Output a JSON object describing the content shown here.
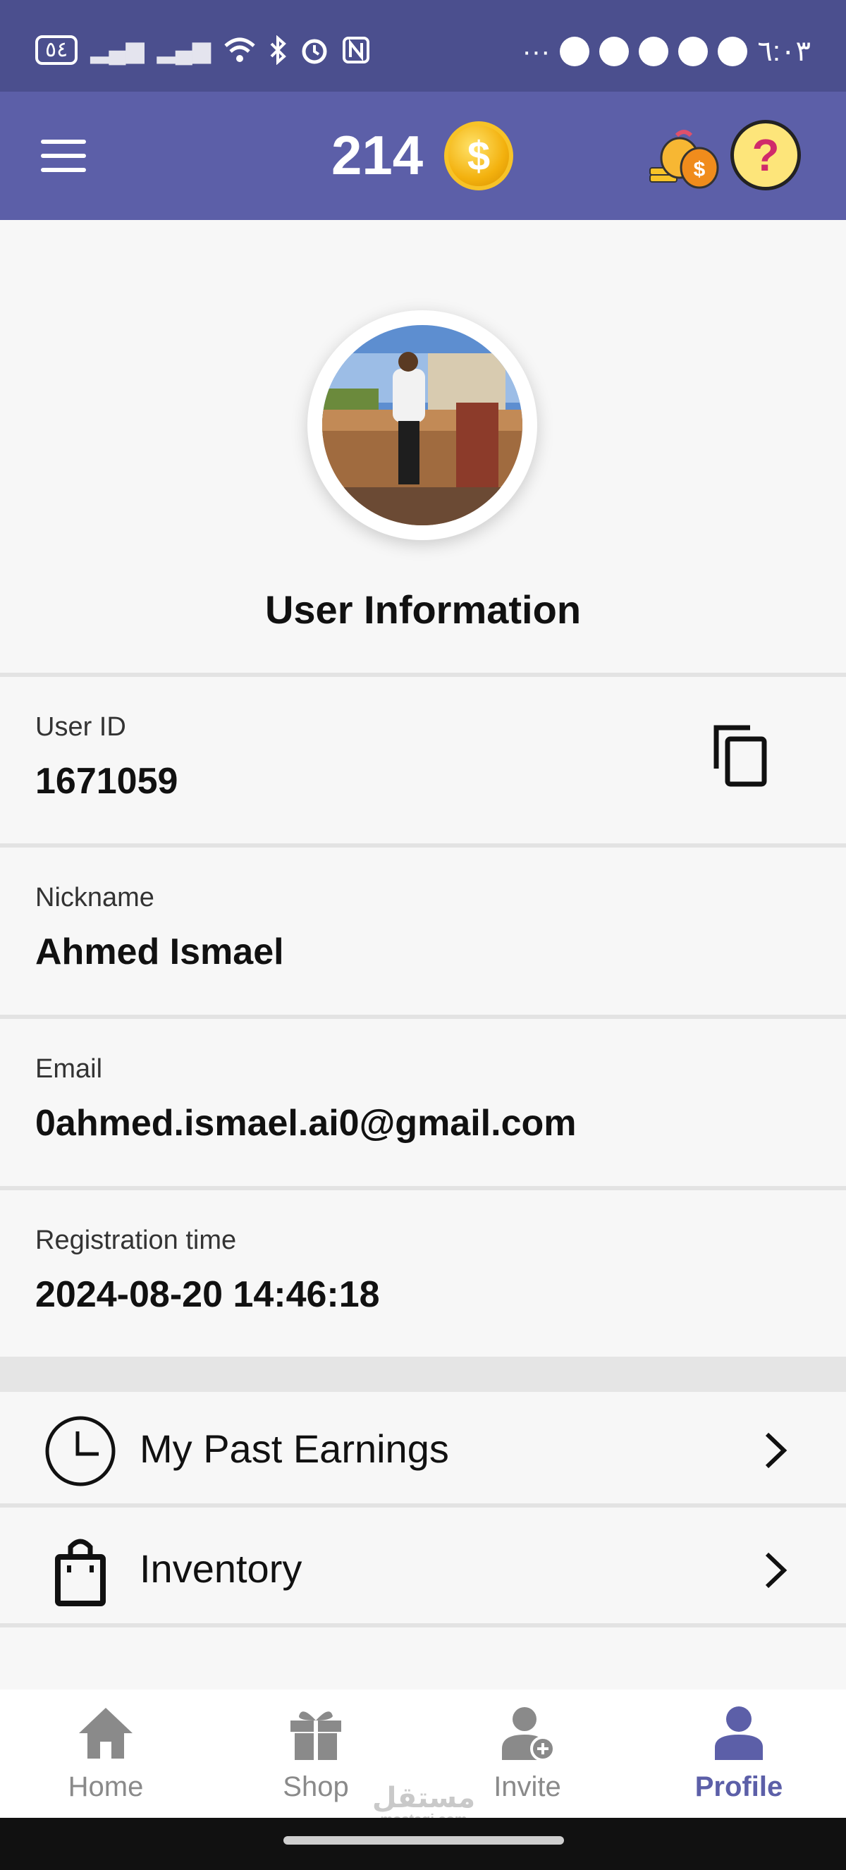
{
  "status_bar": {
    "battery": "٥٤",
    "time": "٦:٠٣",
    "more": "···"
  },
  "header": {
    "coin_balance": "214",
    "coin_symbol": "$",
    "help_symbol": "?"
  },
  "profile": {
    "section_title": "User Information"
  },
  "info": [
    {
      "label": "User ID",
      "value": "1671059"
    },
    {
      "label": "Nickname",
      "value": "Ahmed Ismael"
    },
    {
      "label": "Email",
      "value": "0ahmed.ismael.ai0@gmail.com"
    },
    {
      "label": "Registration time",
      "value": "2024-08-20 14:46:18"
    }
  ],
  "menu": [
    {
      "label": "My Past Earnings",
      "icon": "clock-icon"
    },
    {
      "label": "Inventory",
      "icon": "shopping-bag-icon"
    }
  ],
  "nav": [
    {
      "label": "Home",
      "icon": "home-icon",
      "active": false
    },
    {
      "label": "Shop",
      "icon": "gift-icon",
      "active": false
    },
    {
      "label": "Invite",
      "icon": "add-user-icon",
      "active": false
    },
    {
      "label": "Profile",
      "icon": "person-icon",
      "active": true
    }
  ],
  "watermark": {
    "arabic": "مستقل",
    "latin": "mostaqi.com"
  },
  "colors": {
    "statusbar": "#4b4f8e",
    "appbar": "#5c5fa8",
    "accent": "#5c5fa8",
    "background": "#f7f7f7",
    "coin": "#f3b10e"
  }
}
